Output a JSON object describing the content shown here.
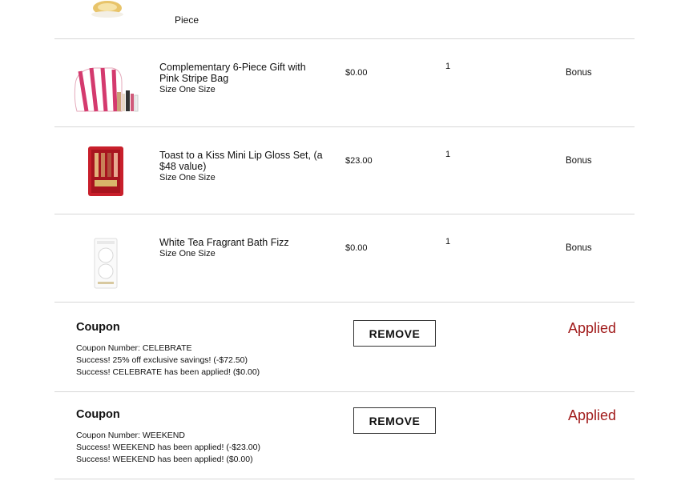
{
  "top_partial": {
    "label": "Piece"
  },
  "items": [
    {
      "name": "Complementary 6-Piece Gift with Pink Stripe Bag",
      "size": "Size One Size",
      "price": "$0.00",
      "qty": "1",
      "status": "Bonus"
    },
    {
      "name": "Toast to a Kiss Mini Lip Gloss Set, (a $48 value)",
      "size": "Size One Size",
      "price": "$23.00",
      "qty": "1",
      "status": "Bonus"
    },
    {
      "name": "White Tea Fragrant Bath Fizz",
      "size": "Size One Size",
      "price": "$0.00",
      "qty": "1",
      "status": "Bonus"
    }
  ],
  "coupons": [
    {
      "title": "Coupon",
      "number": "Coupon Number: CELEBRATE",
      "lines": [
        "Success! 25% off exclusive savings! (-$72.50)",
        "Success! CELEBRATE has been applied! ($0.00)"
      ],
      "button": "REMOVE",
      "status": "Applied"
    },
    {
      "title": "Coupon",
      "number": "Coupon Number: WEEKEND",
      "lines": [
        "Success! WEEKEND has been applied! (-$23.00)",
        "Success! WEEKEND has been applied! ($0.00)"
      ],
      "button": "REMOVE",
      "status": "Applied"
    }
  ]
}
